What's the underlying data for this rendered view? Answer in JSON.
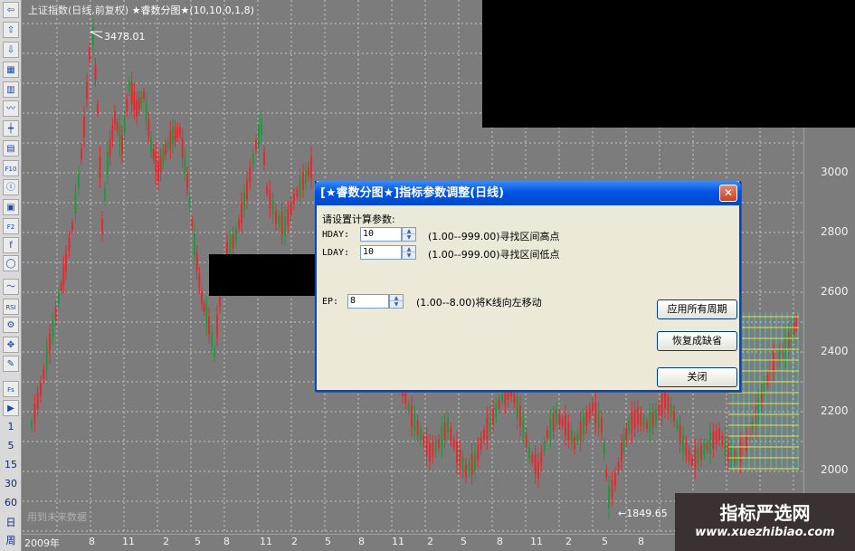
{
  "chart": {
    "title_prefix": "上证指数(日线,前复权)",
    "indicator": "★睿数分图★(10,10,0,1,8)",
    "high_label": "3478.01",
    "low_label": "1849.65",
    "future_note": "用到未来数据",
    "price_ticks": [
      "3000",
      "2800",
      "2600",
      "2400",
      "2200",
      "2000"
    ],
    "date_ticks": [
      "2009年",
      "8",
      "11",
      "2",
      "5",
      "8",
      "11",
      "2",
      "5",
      "8",
      "11",
      "2",
      "5",
      "8",
      "11",
      "2",
      "5",
      "8"
    ],
    "colors": {
      "up": "#e8282c",
      "down": "#1f9a3a",
      "background": "#7c7c7c",
      "grid": "#c8c8c8",
      "bands": "#f1f13a",
      "bands2": "#38d4c8"
    }
  },
  "toolbar": {
    "icons": [
      "back-arrow-icon",
      "up-arrow-icon",
      "down-arrow-icon",
      "zoom-icon",
      "bars-icon",
      "line-icon",
      "candle-icon",
      "layout-icon",
      "f10-icon",
      "info-icon",
      "grid-icon",
      "f2-icon",
      "calc-icon",
      "circle-icon",
      "wave-icon",
      "rsi-icon",
      "tools-icon",
      "move-icon",
      "pencil-icon",
      "fs-icon",
      "export-icon"
    ],
    "icon_glyphs": [
      "⇦",
      "⇧",
      "⇩",
      "▦",
      "▥",
      "〰",
      "┿",
      "▤",
      "F10",
      "ⓘ",
      "▣",
      "F2",
      "f",
      "◯",
      "〜",
      "RSI",
      "⚙",
      "✥",
      "✎",
      "Fs",
      "▶"
    ],
    "periods": [
      "1",
      "5",
      "15",
      "30",
      "60",
      "日",
      "周"
    ]
  },
  "dialog": {
    "title": "[★睿数分图★]指标参数调整(日线)",
    "close_label": "✕",
    "prompt": "请设置计算参数:",
    "params": [
      {
        "name": "HDAY:",
        "value": "10",
        "range": "(1.00--999.00)寻找区间高点"
      },
      {
        "name": "LDAY:",
        "value": "10",
        "range": "(1.00--999.00)寻找区间低点"
      },
      {
        "name": "EP:",
        "value": "8",
        "range": "(1.00--8.00)将K线向左移动"
      }
    ],
    "buttons": {
      "apply_all": "应用所有周期",
      "restore_default": "恢复成缺省",
      "close": "关闭"
    }
  },
  "watermark": {
    "title": "指标严选网",
    "url": "www.xuezhibiao.com"
  }
}
